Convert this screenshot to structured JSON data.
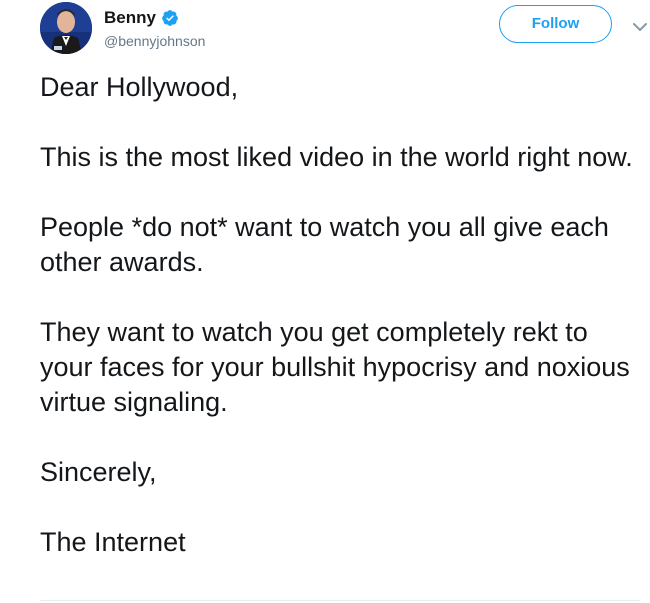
{
  "tweet": {
    "author": {
      "display_name": "Benny",
      "handle": "@bennyjohnson",
      "verified": true,
      "avatar_icon": "avatar-photo"
    },
    "follow_label": "Follow",
    "menu_icon": "chevron-down-icon",
    "paragraphs": [
      "Dear Hollywood,",
      "This is the most liked video in the world right now.",
      "People *do not* want to watch you all give each other awards.",
      "They want to watch you get completely rekt to your faces for your bullshit hypocrisy and noxious virtue signaling.",
      "Sincerely,",
      "The Internet"
    ]
  },
  "colors": {
    "accent": "#1da1f2",
    "text": "#14171a",
    "secondary_text": "#657786"
  }
}
